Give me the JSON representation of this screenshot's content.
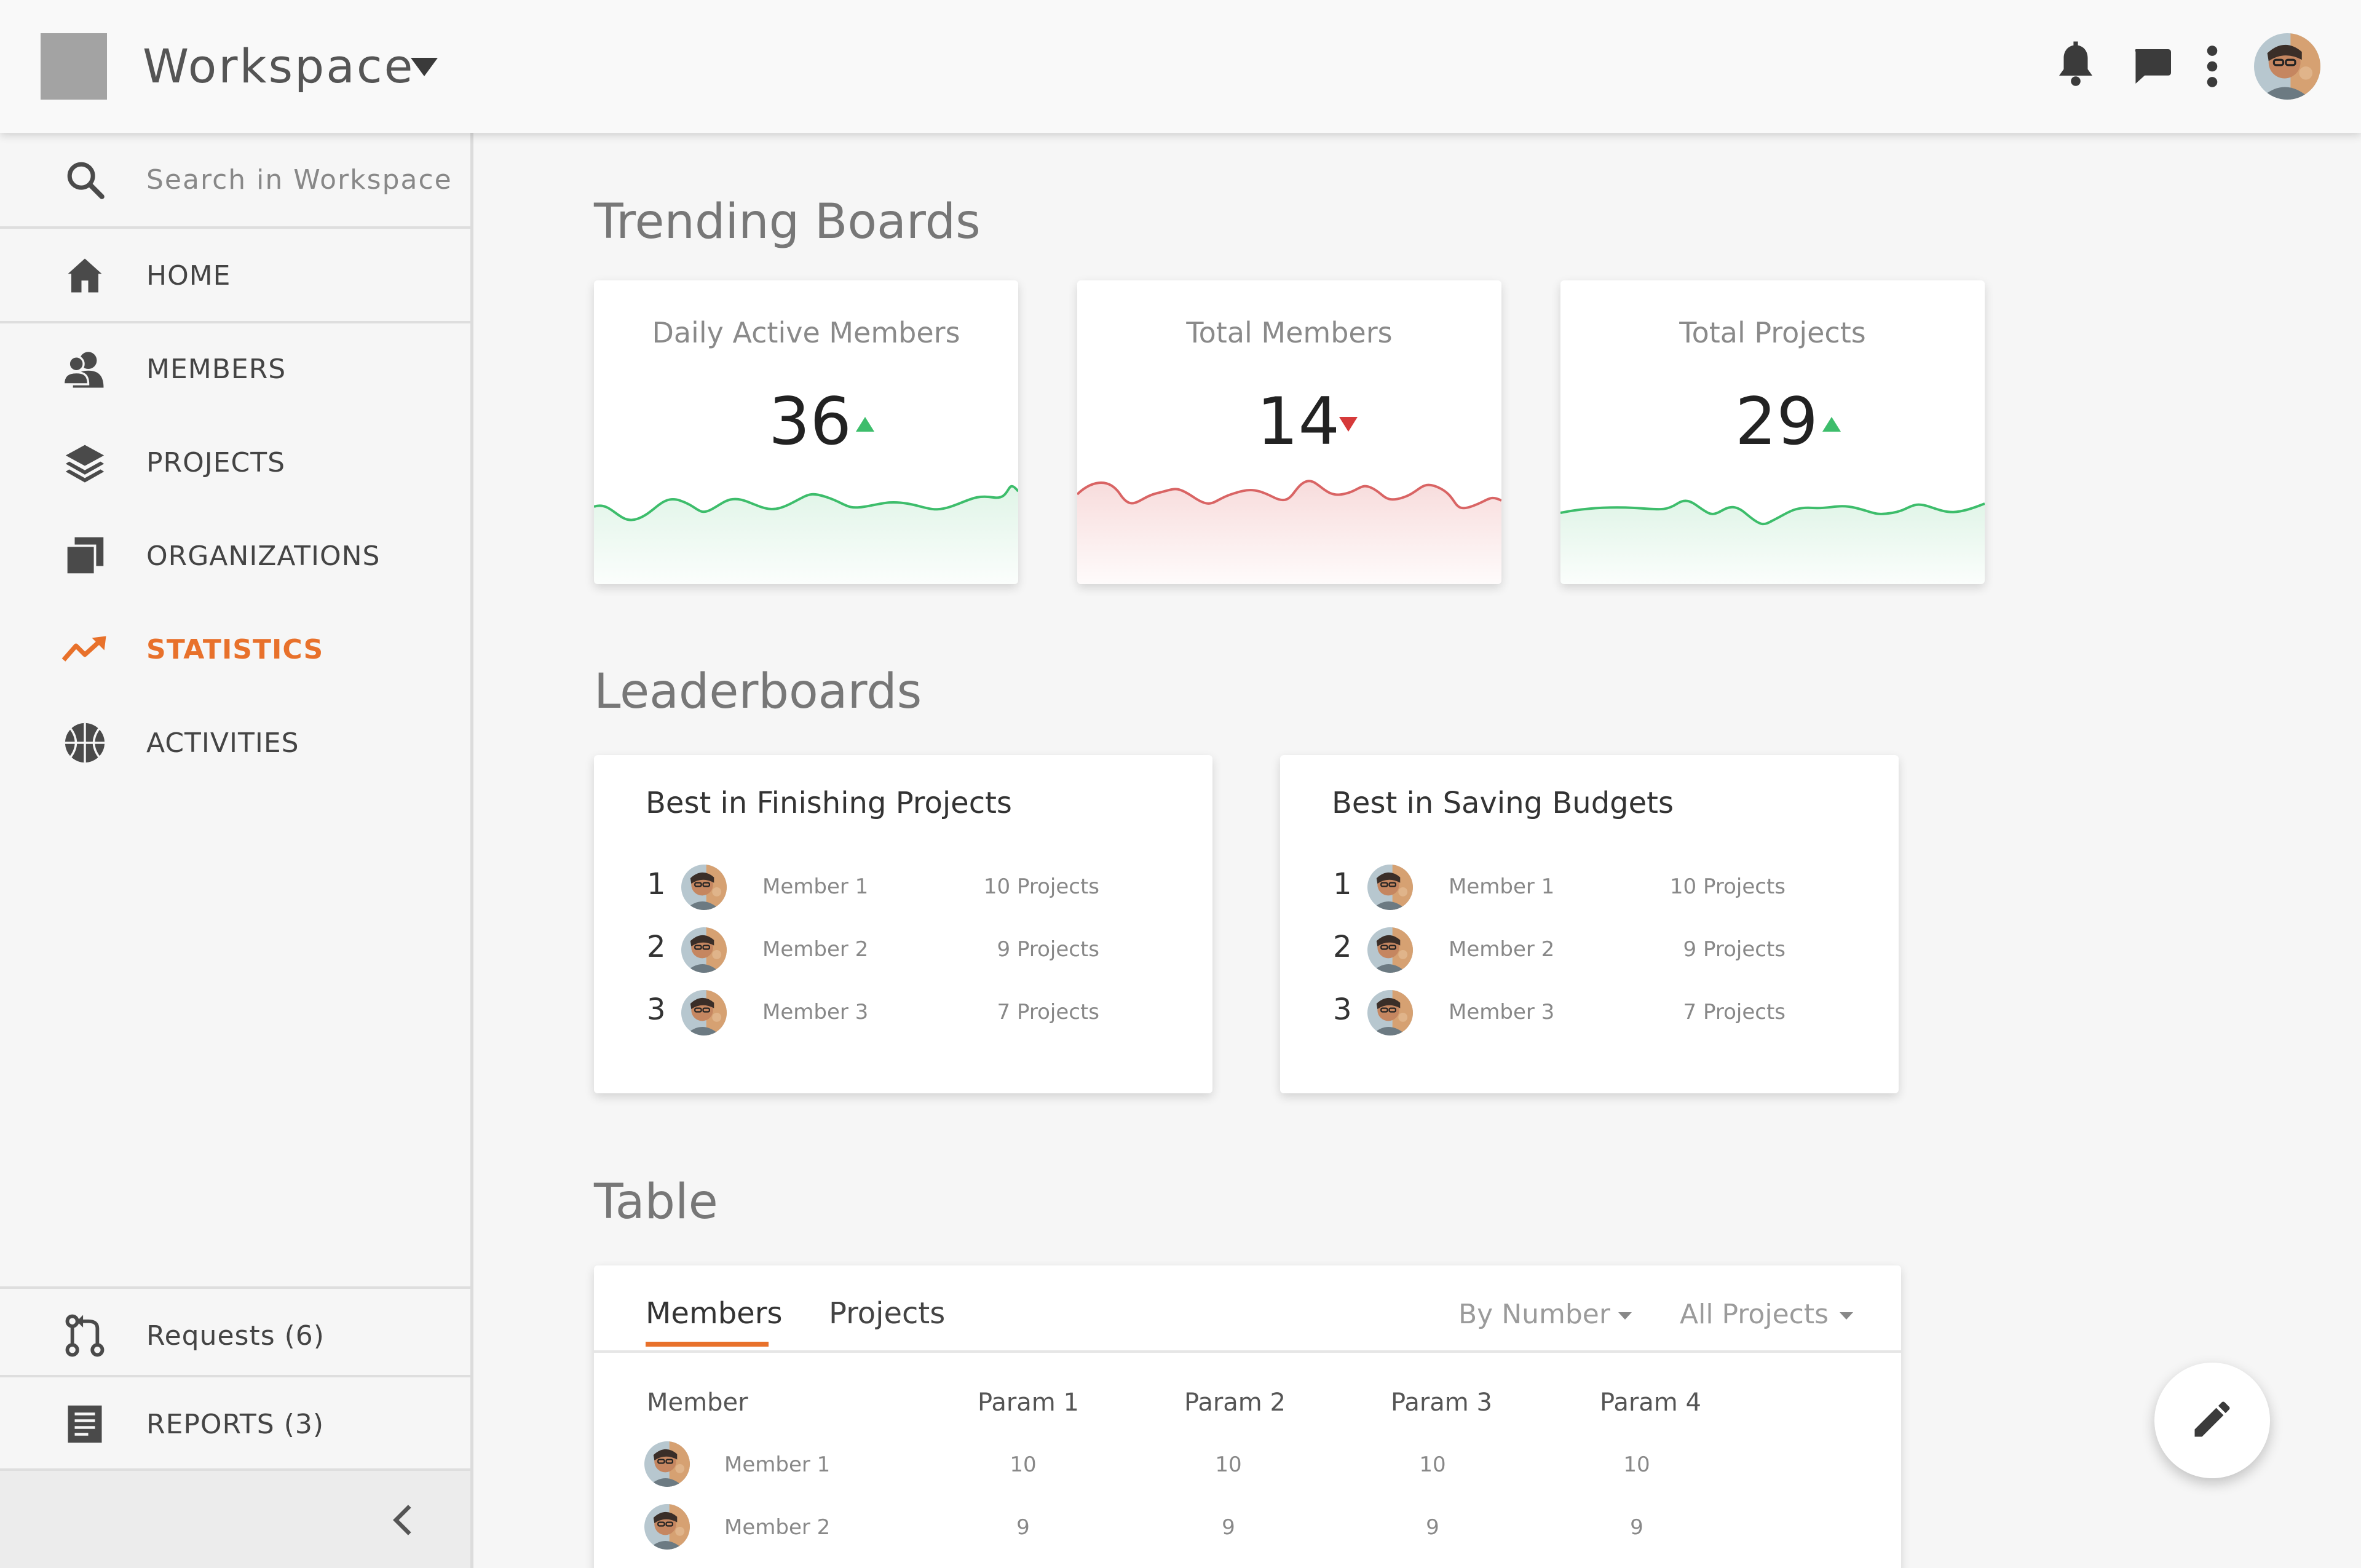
{
  "header": {
    "workspace_title": "Workspace",
    "icons": [
      "bell-icon",
      "chat-icon",
      "more-vert-icon",
      "user-avatar"
    ]
  },
  "sidebar": {
    "search_placeholder": "Search in Workspace",
    "items": [
      {
        "label": "HOME",
        "icon": "home-icon"
      },
      {
        "label": "MEMBERS",
        "icon": "members-icon"
      },
      {
        "label": "PROJECTS",
        "icon": "layers-icon"
      },
      {
        "label": "ORGANIZATIONS",
        "icon": "organizations-icon"
      },
      {
        "label": "STATISTICS",
        "icon": "trending-up-icon",
        "active": true
      },
      {
        "label": "ACTIVITIES",
        "icon": "basketball-icon"
      }
    ],
    "bottom_items": [
      {
        "label": "Requests (6)",
        "icon": "pull-request-icon"
      },
      {
        "label": "REPORTS (3)",
        "icon": "reports-icon"
      }
    ]
  },
  "trending": {
    "title": "Trending Boards",
    "cards": [
      {
        "caption": "Daily Active Members",
        "value": "36",
        "trend": "up"
      },
      {
        "caption": "Total Members",
        "value": "14",
        "trend": "down"
      },
      {
        "caption": "Total Projects",
        "value": "29",
        "trend": "up"
      }
    ]
  },
  "leaderboards": {
    "title": "Leaderboards",
    "boards": [
      {
        "title": "Best in Finishing Projects",
        "rows": [
          {
            "rank": "1",
            "member": "Member 1",
            "value": "10 Projects"
          },
          {
            "rank": "2",
            "member": "Member 2",
            "value": "9 Projects"
          },
          {
            "rank": "3",
            "member": "Member 3",
            "value": "7 Projects"
          }
        ]
      },
      {
        "title": "Best in Saving Budgets",
        "rows": [
          {
            "rank": "1",
            "member": "Member 1",
            "value": "10 Projects"
          },
          {
            "rank": "2",
            "member": "Member 2",
            "value": "9 Projects"
          },
          {
            "rank": "3",
            "member": "Member 3",
            "value": "7 Projects"
          }
        ]
      }
    ]
  },
  "table": {
    "title": "Table",
    "tabs": [
      "Members",
      "Projects"
    ],
    "active_tab": "Members",
    "filters": {
      "sort": "By Number",
      "scope": "All Projects"
    },
    "columns": [
      "Member",
      "Param 1",
      "Param 2",
      "Param 3",
      "Param 4"
    ],
    "rows": [
      {
        "member": "Member 1",
        "values": [
          "10",
          "10",
          "10",
          "10"
        ]
      },
      {
        "member": "Member 2",
        "values": [
          "9",
          "9",
          "9",
          "9"
        ]
      }
    ]
  },
  "colors": {
    "accent": "#e8712b",
    "up": "#3dbd6b",
    "down": "#d63a3a"
  }
}
